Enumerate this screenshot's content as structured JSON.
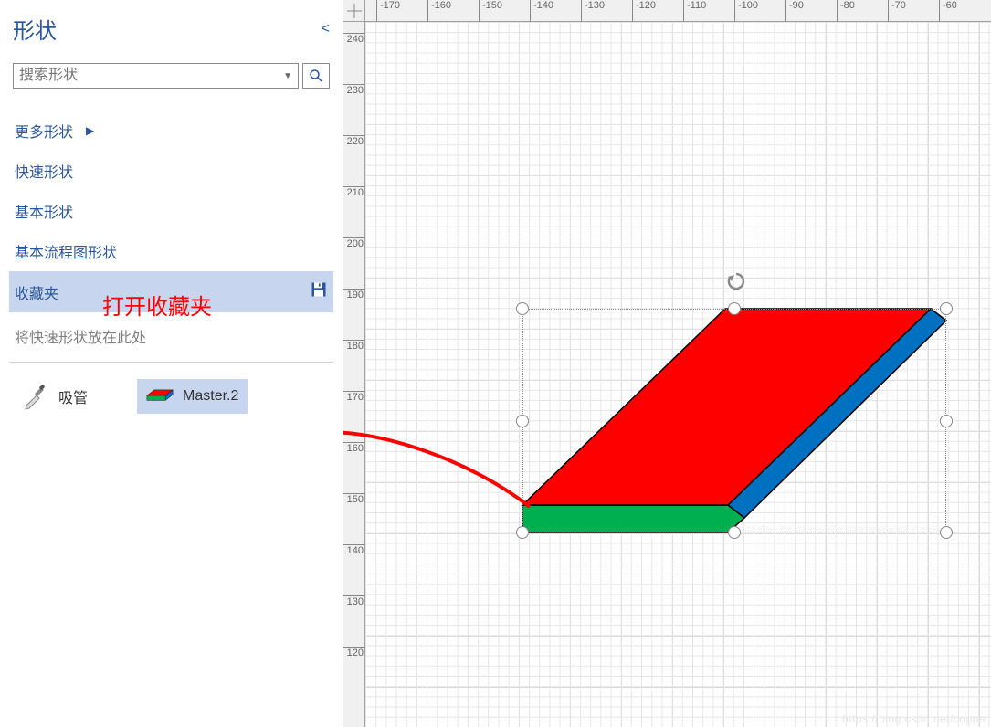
{
  "panel": {
    "title": "形状",
    "collapse_tooltip": "collapse"
  },
  "search": {
    "placeholder": "搜索形状"
  },
  "nav": {
    "more_shapes": "更多形状",
    "quick_shapes": "快速形状",
    "basic_shapes": "基本形状",
    "basic_flowchart": "基本流程图形状",
    "favorites": "收藏夹"
  },
  "annotations": {
    "open_favorites": "打开收藏夹"
  },
  "hint": "将快速形状放在此处",
  "stencils": {
    "eyedropper": "吸管",
    "master2": "Master.2"
  },
  "ruler": {
    "h_ticks": [
      "-170",
      "-160",
      "-150",
      "-140",
      "-130",
      "-120",
      "-110",
      "-100",
      "-90",
      "-80",
      "-70",
      "-60"
    ],
    "v_ticks": [
      "240",
      "230",
      "220",
      "210",
      "200",
      "190",
      "180",
      "170",
      "160",
      "150",
      "140",
      "130",
      "120"
    ]
  },
  "colors": {
    "primary_blue": "#2b579a",
    "selection_fill": "#c7d6ee",
    "shape_top": "#ff0000",
    "shape_side_blue": "#0070c0",
    "shape_front_green": "#00b050",
    "annotation_red": "#ff0000"
  },
  "watermark": "https://blog.csdn.net/coppa"
}
